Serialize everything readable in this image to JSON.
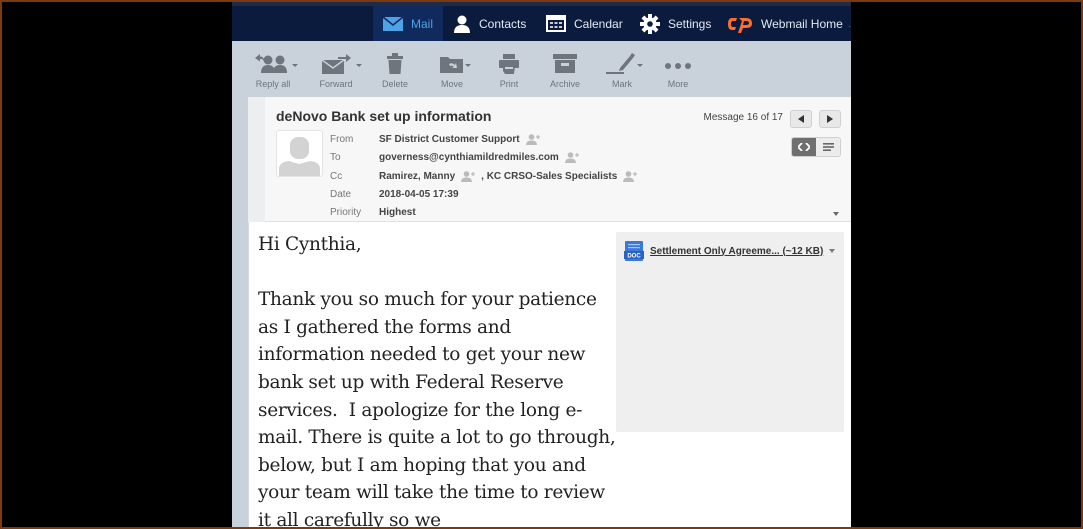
{
  "nav": {
    "items": [
      {
        "label": "Mail",
        "icon": "mail-icon",
        "active": true
      },
      {
        "label": "Contacts",
        "icon": "contacts-icon",
        "active": false
      },
      {
        "label": "Calendar",
        "icon": "calendar-icon",
        "active": false
      },
      {
        "label": "Settings",
        "icon": "gear-icon",
        "active": false
      },
      {
        "label": "Webmail Home",
        "icon": "cpanel-logo-icon",
        "active": false
      }
    ]
  },
  "toolbar": {
    "reply_all": "Reply all",
    "forward": "Forward",
    "delete": "Delete",
    "move": "Move",
    "print": "Print",
    "archive": "Archive",
    "mark": "Mark",
    "more": "More"
  },
  "message": {
    "subject": "deNovo Bank set up information",
    "counter": "Message 16 of 17",
    "labels": {
      "from": "From",
      "to": "To",
      "cc": "Cc",
      "date": "Date",
      "priority": "Priority"
    },
    "from": "SF District Customer Support",
    "to": "governess@cynthiamildredmiles.com",
    "cc": [
      "Ramirez, Manny",
      ", KC CRSO-Sales Specialists"
    ],
    "date": "2018-04-05 17:39",
    "priority": "Highest",
    "body": "Hi Cynthia,\n\nThank you so much for your patience as I gathered the forms and information needed to get your new bank set up with Federal Reserve services.  I apologize for the long e-mail. There is quite a lot to go through, below, but I am hoping that you and your team will take the time to review it all carefully so we"
  },
  "attachment": {
    "name": "Settlement Only Agreeme...",
    "size": "(~12 KB)",
    "type_badge": "DOC"
  },
  "colors": {
    "nav_bg": "#0b1b3d",
    "active_accent": "#4ea2e6",
    "cpanel_orange": "#ff6c2c"
  }
}
